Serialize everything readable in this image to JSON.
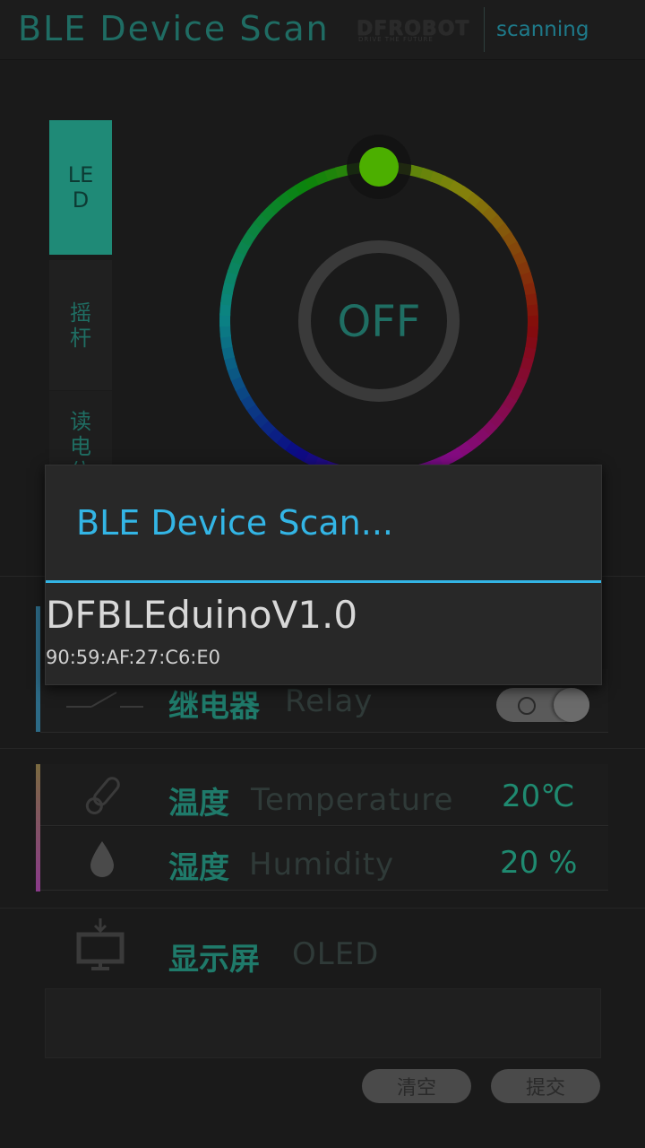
{
  "header": {
    "title": "BLE Device Scan",
    "brand": "DFROBOT",
    "brand_tagline": "DRIVE THE FUTURE",
    "status": "scanning"
  },
  "tabs": [
    {
      "label": "LED",
      "active": true
    },
    {
      "label": "摇杆",
      "active": false
    },
    {
      "label": "读电位",
      "active": false
    }
  ],
  "led": {
    "center_label": "OFF"
  },
  "relay": {
    "label_zh": "继电器",
    "label_en": "Relay",
    "on": false
  },
  "temperature": {
    "label_zh": "温度",
    "label_en": "Temperature",
    "value": "20℃"
  },
  "humidity": {
    "label_zh": "湿度",
    "label_en": "Humidity",
    "value": "20 %"
  },
  "oled": {
    "label_zh": "显示屏",
    "label_en": "OLED",
    "text": ""
  },
  "buttons": {
    "clear": "清空",
    "submit": "提交"
  },
  "dialog": {
    "title": "BLE Device Scan...",
    "devices": [
      {
        "name": "DFBLEduinoV1.0",
        "address": "90:59:AF:27:C6:E0"
      }
    ]
  },
  "colors": {
    "accent": "#33b5e5",
    "teal": "#1f8a77",
    "knob": "#4caf00"
  }
}
